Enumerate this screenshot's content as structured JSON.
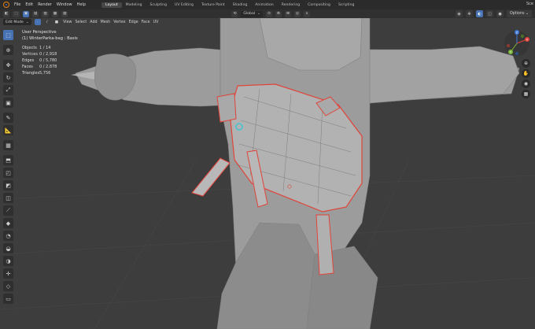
{
  "menubar": {
    "items": [
      "File",
      "Edit",
      "Render",
      "Window",
      "Help"
    ],
    "workspaces": [
      "Layout",
      "Modeling",
      "Sculpting",
      "UV Editing",
      "Texture Paint",
      "Shading",
      "Animation",
      "Rendering",
      "Compositing",
      "Scripting"
    ],
    "active_workspace": "Layout",
    "scene": "Sce"
  },
  "header": {
    "orientation": "Global",
    "options_label": "Options"
  },
  "edit_header": {
    "mode": "Edit Mode",
    "menus": [
      "View",
      "Select",
      "Add",
      "Mesh",
      "Vertex",
      "Edge",
      "Face",
      "UV"
    ]
  },
  "viewport": {
    "view_name": "User Perspective",
    "object_name": "(1) WinterParka-bag : Basis",
    "stats": [
      {
        "label": "Objects",
        "value": "1 / 14"
      },
      {
        "label": "Vertices",
        "value": "0 / 2,918"
      },
      {
        "label": "Edges",
        "value": "0 / 5,780"
      },
      {
        "label": "Faces",
        "value": "0 / 2,878"
      },
      {
        "label": "Triangles",
        "value": "5,756"
      }
    ]
  },
  "gizmo": {
    "x_label": "X",
    "y_label": "Y",
    "z_label": "Z"
  },
  "icons": {
    "toolbar": [
      "select-box-icon",
      "cursor-icon",
      "move-icon",
      "rotate-icon",
      "scale-icon",
      "transform-icon",
      "annotate-icon",
      "measure-icon",
      "add-cube-icon",
      "extrude-icon",
      "inset-icon",
      "bevel-icon",
      "loop-cut-icon",
      "knife-icon",
      "poly-build-icon",
      "spin-icon",
      "smooth-icon",
      "edge-slide-icon",
      "shrink-icon",
      "shear-icon",
      "rip-icon"
    ]
  },
  "colors": {
    "accent": "#4772b3",
    "selection_outline": "#e0443a",
    "mesh": "#9c9c9c",
    "background": "#3d3d3d"
  }
}
